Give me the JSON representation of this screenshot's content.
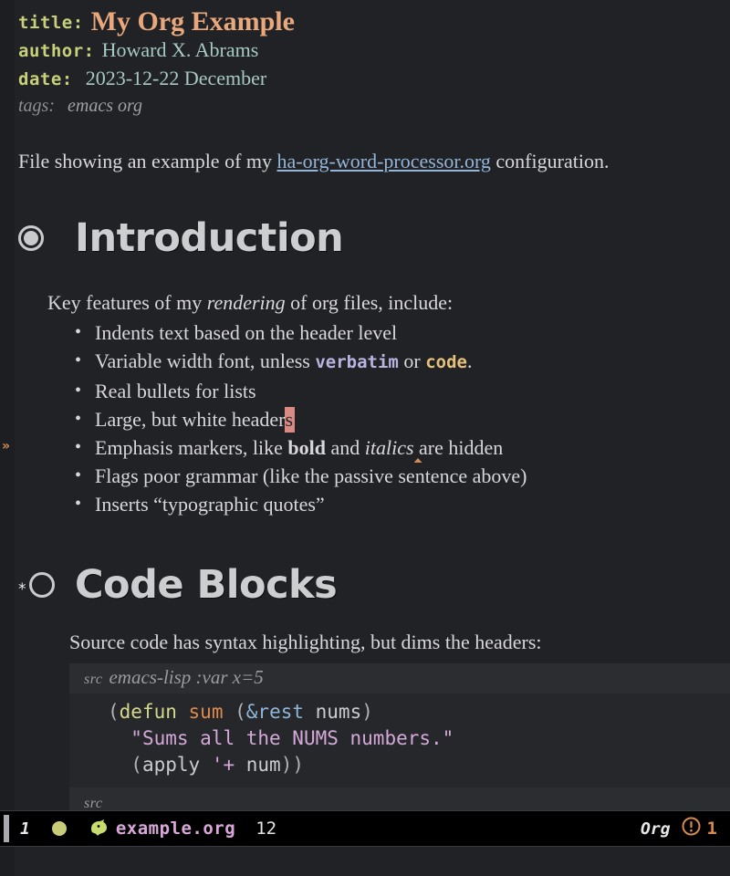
{
  "window": {
    "background": "#212226",
    "foreground": "#d8d8da"
  },
  "keywords": [
    {
      "key": "title:",
      "value": "My Org Example",
      "value_color": "#e8a87c"
    },
    {
      "key": "author:",
      "value": "Howard X. Abrams",
      "value_color": "#a7c9c4"
    },
    {
      "key": "date:",
      "value": "2023-12-22 December",
      "value_color": "#a7c9c4"
    }
  ],
  "tags": {
    "key": "tags:",
    "value": "emacs org"
  },
  "intro": {
    "before_link": "File showing an example of my ",
    "link_text": "ha-org-word-processor.org",
    "link_color": "#92b5d8",
    "after_link": " configuration."
  },
  "sections": [
    {
      "bullet_icon": "filled-ring-bullet",
      "stars": "",
      "title": "Introduction",
      "lead_before_em": "Key features of my ",
      "lead_em": "rendering",
      "lead_after_em": " of org files, include:",
      "bullets": [
        {
          "id": "indents",
          "text": "Indents text based on the header level"
        },
        {
          "id": "variable-width",
          "parts": [
            {
              "type": "plain",
              "text": "Variable width font, unless "
            },
            {
              "type": "verbatim",
              "text": "verbatim"
            },
            {
              "type": "plain",
              "text": " or "
            },
            {
              "type": "code",
              "text": "code"
            },
            {
              "type": "plain",
              "text": "."
            }
          ]
        },
        {
          "id": "real-bullets",
          "text": "Real bullets for lists"
        },
        {
          "id": "white-headers",
          "parts": [
            {
              "type": "plain",
              "text": "Large, but white header"
            },
            {
              "type": "cursor",
              "text": "s"
            }
          ]
        },
        {
          "id": "emphasis-hidden",
          "parts": [
            {
              "type": "plain",
              "text": "Emphasis markers, like "
            },
            {
              "type": "bold",
              "text": "bold"
            },
            {
              "type": "plain",
              "text": " and "
            },
            {
              "type": "italic",
              "text": "italics"
            },
            {
              "type": "grammar",
              "text": " "
            },
            {
              "type": "plain",
              "text": "are hidden"
            }
          ]
        },
        {
          "id": "grammar-flag",
          "text": "Flags poor grammar (like the passive sentence above)"
        },
        {
          "id": "typographic-quotes",
          "text": "Inserts “typographic quotes”"
        }
      ]
    },
    {
      "bullet_icon": "open-ring-bullet",
      "stars": "*",
      "title": "Code Blocks",
      "lead": "Source code has syntax highlighting, but dims the headers:",
      "src_block": {
        "begin_tag": "src",
        "begin_args": "emacs-lisp :var x=5",
        "end_tag": "src",
        "lines": [
          [
            {
              "cls": "c-paren",
              "text": "("
            },
            {
              "cls": "c-kw",
              "text": "defun"
            },
            {
              "cls": "c-var",
              "text": " "
            },
            {
              "cls": "c-fn",
              "text": "sum"
            },
            {
              "cls": "c-var",
              "text": " "
            },
            {
              "cls": "c-paren",
              "text": "("
            },
            {
              "cls": "c-amp",
              "text": "&rest"
            },
            {
              "cls": "c-var",
              "text": " nums"
            },
            {
              "cls": "c-paren",
              "text": ")"
            }
          ],
          [
            {
              "cls": "c-var",
              "text": "  "
            },
            {
              "cls": "c-str",
              "text": "\"Sums all the NUMS numbers.\""
            }
          ],
          [
            {
              "cls": "c-var",
              "text": "  "
            },
            {
              "cls": "c-paren",
              "text": "("
            },
            {
              "cls": "c-var",
              "text": "apply "
            },
            {
              "cls": "c-str",
              "text": "'+"
            },
            {
              "cls": "c-var",
              "text": " num"
            },
            {
              "cls": "c-paren",
              "text": "))"
            }
          ]
        ]
      }
    }
  ],
  "fringe": {
    "marker_glyph": "»",
    "marker_color": "#d08b5a"
  },
  "modeline": {
    "window_number": "1",
    "status_dot_color": "#c7cc78",
    "buffer_name": "example.org",
    "buffer_name_color": "#d9a8d9",
    "position": "12",
    "major_mode": "Org",
    "error_count": "1",
    "error_color": "#d68a50"
  }
}
